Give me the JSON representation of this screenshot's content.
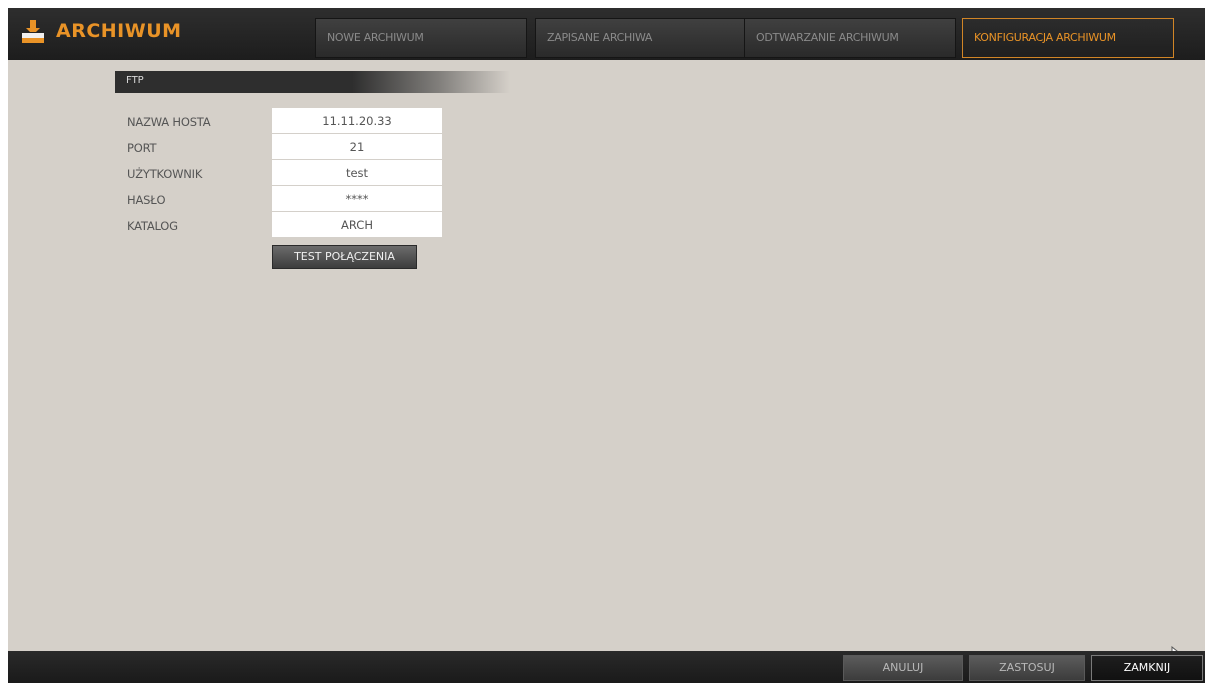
{
  "app": {
    "title": "ARCHIWUM",
    "logo_icon": "archive-stamp-icon",
    "accent_color": "#e99327"
  },
  "tabs": [
    {
      "label": "NOWE ARCHIWUM",
      "active": false
    },
    {
      "label": "ZAPISANE ARCHIWA",
      "active": false
    },
    {
      "label": "ODTWARZANIE ARCHIWUM",
      "active": false
    },
    {
      "label": "KONFIGURACJA ARCHIWUM",
      "active": true
    }
  ],
  "section": {
    "title": "FTP"
  },
  "form": {
    "fields": [
      {
        "label": "NAZWA HOSTA",
        "value": "11.11.20.33"
      },
      {
        "label": "PORT",
        "value": "21"
      },
      {
        "label": "UŻYTKOWNIK",
        "value": "test"
      },
      {
        "label": "HASŁO",
        "value": "****"
      },
      {
        "label": "KATALOG",
        "value": "ARCH"
      }
    ],
    "test_button_label": "TEST POŁĄCZENIA"
  },
  "footer": {
    "cancel_label": "ANULUJ",
    "apply_label": "ZASTOSUJ",
    "close_label": "ZAMKNIJ"
  }
}
